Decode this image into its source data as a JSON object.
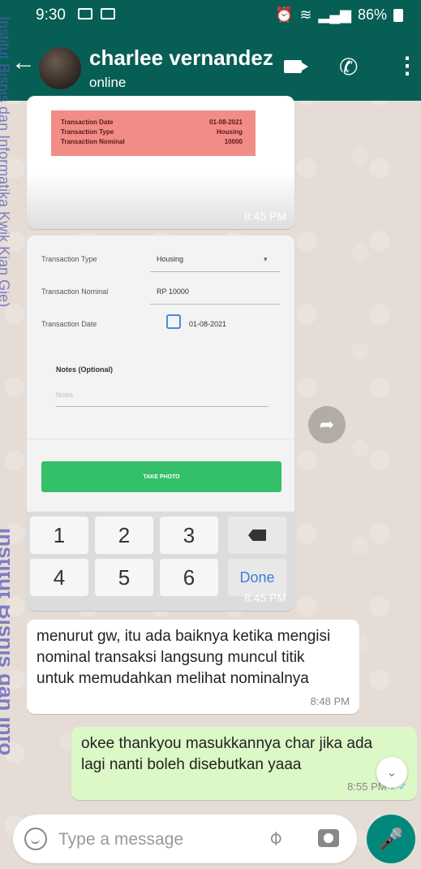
{
  "status_bar": {
    "time": "9:30",
    "battery": "86%"
  },
  "header": {
    "contact_name": "charlee vernandez",
    "contact_status": "online"
  },
  "messages": {
    "image1": {
      "rows": [
        {
          "label": "Transaction Date",
          "value": "01-08-2021"
        },
        {
          "label": "Transaction Type",
          "value": "Housing"
        },
        {
          "label": "Transaction Nominal",
          "value": "10000"
        }
      ],
      "time": "8:45 PM"
    },
    "image2": {
      "type_label": "Transaction Type",
      "type_value": "Housing",
      "nominal_label": "Transaction Nominal",
      "nominal_value": "RP 10000",
      "date_label": "Transaction Date",
      "date_value": "01-08-2021",
      "notes_label": "Notes (Optional)",
      "notes_placeholder": "Notes",
      "take_photo": "TAKE PHOTO",
      "keys": [
        "1",
        "2",
        "3",
        "4",
        "5",
        "6"
      ],
      "done_label": "Done",
      "time": "8:45 PM"
    },
    "incoming": {
      "text": "menurut gw, itu ada baiknya ketika mengisi nominal transaksi langsung muncul titik untuk memudahkan melihat nominalnya",
      "time": "8:48 PM"
    },
    "outgoing": {
      "text": "okee thankyou masukkannya char jika ada lagi nanti boleh disebutkan yaaa",
      "time": "8:55 PM"
    }
  },
  "input": {
    "placeholder": "Type a message"
  },
  "watermark": {
    "line1": "Institut Bisnis dan Informatika Kwik Kian Gie)",
    "line2": "Institut Bisnis dan Info"
  },
  "icons": [
    "back-arrow-icon",
    "video-call-icon",
    "phone-icon",
    "more-menu-icon",
    "forward-icon",
    "scroll-down-icon",
    "emoji-icon",
    "attach-icon",
    "camera-icon",
    "mic-icon",
    "backspace-icon",
    "calendar-icon"
  ],
  "colors": {
    "header": "#075e54",
    "outgoing_bubble": "#dcf8c6",
    "mic_button": "#00897b",
    "take_photo": "#34c06b"
  }
}
